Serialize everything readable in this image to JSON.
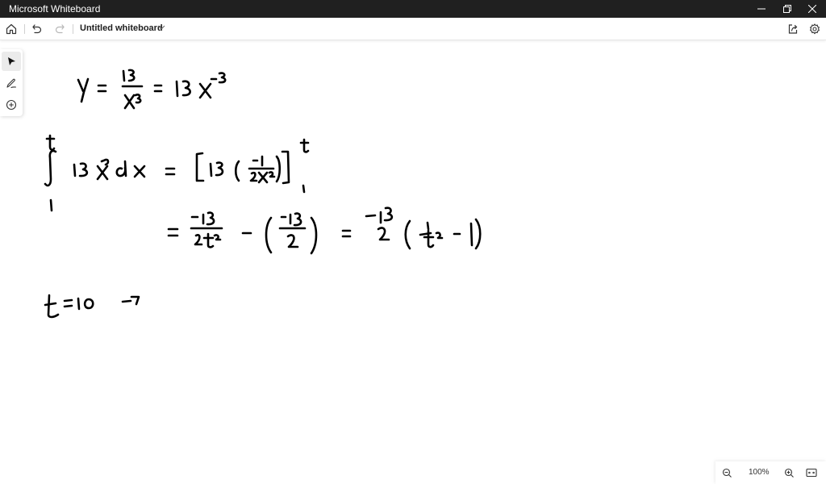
{
  "window": {
    "title": "Microsoft Whiteboard",
    "controls": [
      "minimize",
      "restore",
      "close"
    ]
  },
  "toolbar": {
    "home_icon": "home-icon",
    "undo_icon": "undo-icon",
    "redo_icon": "redo-icon",
    "whiteboard_title": "Untitled whiteboard",
    "title_dropdown_icon": "chevron-down-icon",
    "share_icon": "share-icon",
    "settings_icon": "gear-icon"
  },
  "side_tools": [
    {
      "name": "select",
      "icon": "pointer-icon",
      "active": true
    },
    {
      "name": "pen",
      "icon": "pen-icon",
      "active": false
    },
    {
      "name": "add",
      "icon": "plus-circle-icon",
      "active": false
    }
  ],
  "canvas": {
    "handwritten_lines": [
      "y = 13/x^3 = 13x^-3",
      "∫_1^t 13x^-3 dx = [13(-1/(2x^2))]_1^t",
      "= -13/(2t^2) - (-13/2) = -13/2 (1/t^2 - 1)",
      "t = 10 ->"
    ]
  },
  "zoom": {
    "zoom_out_icon": "zoom-out-icon",
    "level": "100%",
    "zoom_in_icon": "zoom-in-icon",
    "fit_icon": "fit-to-screen-icon"
  }
}
